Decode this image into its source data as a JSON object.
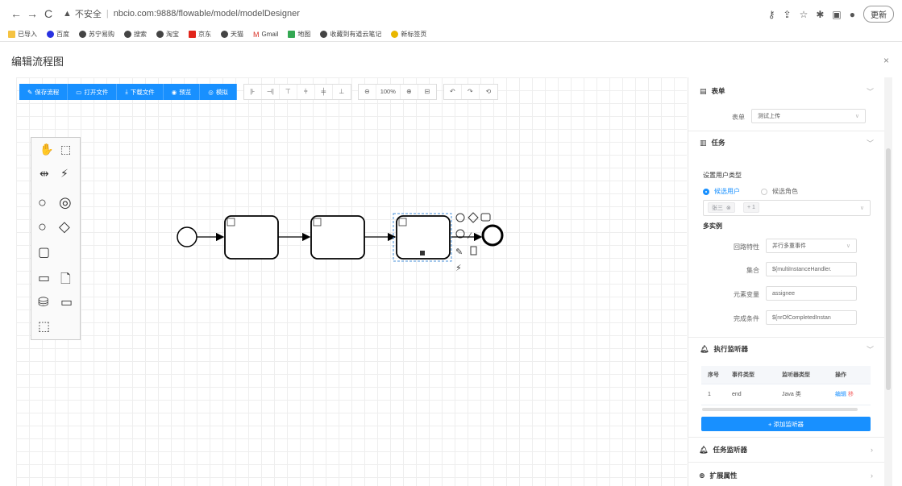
{
  "browser": {
    "back": "←",
    "forward": "→",
    "reload": "C",
    "security_text": "不安全",
    "url": "nbcio.com:9888/flowable/model/modelDesigner",
    "update_label": "更新"
  },
  "bookmarks": [
    "已导入",
    "百度",
    "苏宁易购",
    "搜索",
    "淘宝",
    "京东",
    "天猫",
    "Gmail",
    "地图",
    "收藏到有道云笔记",
    "新标签页"
  ],
  "dialog": {
    "title": "编辑流程图",
    "close": "×"
  },
  "toolbar": {
    "buttons": [
      {
        "icon": "✎",
        "label": "保存流程"
      },
      {
        "icon": "▭",
        "label": "打开文件"
      },
      {
        "icon": "⤓",
        "label": "下载文件"
      },
      {
        "icon": "◉",
        "label": "预览"
      },
      {
        "icon": "◎",
        "label": "模拟"
      }
    ],
    "zoom": "100%"
  },
  "panel": {
    "form_section": {
      "title": "表单",
      "field_label": "表单",
      "field_value": "测试上传"
    },
    "task_section": {
      "title": "任务",
      "user_type_label": "设置用户类型",
      "radio_candidate_user": "候选用户",
      "radio_candidate_role": "候选角色",
      "tag_user": "张三",
      "tag_more": "+ 1",
      "multi_instance_label": "多实例",
      "loop_label": "回路特性",
      "loop_value": "并行多重事件",
      "collection_label": "集合",
      "collection_value": "${multiInstanceHandler.",
      "element_var_label": "元素变量",
      "element_var_value": "assignee",
      "complete_label": "完成条件",
      "complete_value": "${nrOfCompletedInstan"
    },
    "exec_listener": {
      "title": "执行监听器",
      "columns": [
        "序号",
        "事件类型",
        "监听器类型",
        "操作"
      ],
      "rows": [
        {
          "index": "1",
          "event": "end",
          "type": "Java 类",
          "edit": "编辑",
          "remove": "移"
        }
      ],
      "add_label": "+ 添加监听器"
    },
    "task_listener": {
      "title": "任务监听器"
    },
    "ext_props": {
      "title": "扩展属性"
    }
  }
}
